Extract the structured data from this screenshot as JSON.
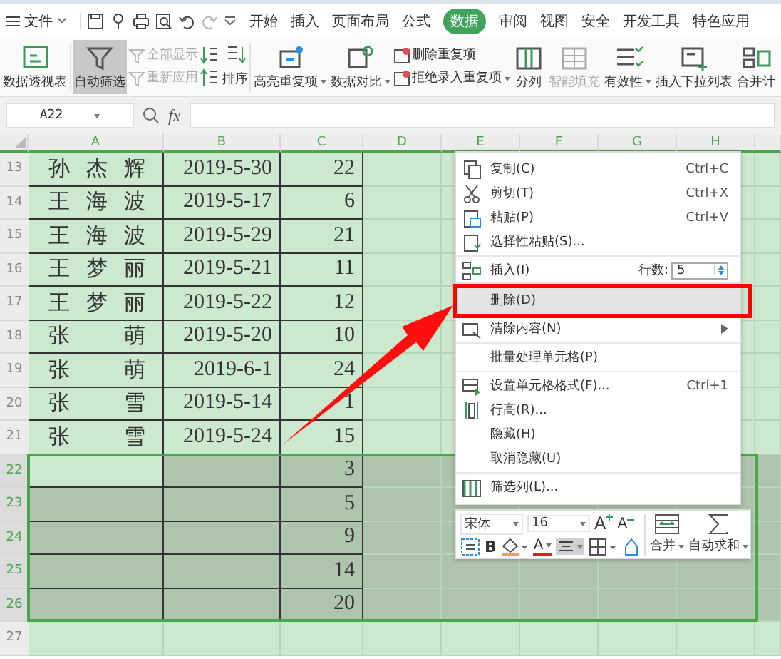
{
  "menu_bar": {
    "file": "文件",
    "tabs": [
      {
        "label": "开始",
        "selected": false
      },
      {
        "label": "插入",
        "selected": false
      },
      {
        "label": "页面布局",
        "selected": false
      },
      {
        "label": "公式",
        "selected": false
      },
      {
        "label": "数据",
        "selected": true
      },
      {
        "label": "审阅",
        "selected": false
      },
      {
        "label": "视图",
        "selected": false
      },
      {
        "label": "安全",
        "selected": false
      },
      {
        "label": "开发工具",
        "selected": false
      },
      {
        "label": "特色应用",
        "selected": false
      }
    ]
  },
  "ribbon": [
    {
      "kind": "large",
      "label": "数据透视表",
      "on": false,
      "disabled": false,
      "dropdown": false
    },
    {
      "kind": "large",
      "label": "自动筛选",
      "on": true,
      "disabled": false,
      "dropdown": false
    },
    {
      "kind": "stack",
      "items": [
        {
          "label": "全部显示",
          "disabled": true,
          "dropdown": false
        },
        {
          "label": "重新应用",
          "disabled": true,
          "dropdown": false
        }
      ]
    },
    {
      "kind": "sort",
      "label": "排序"
    },
    {
      "kind": "large",
      "label": "高亮重复项",
      "on": false,
      "disabled": false,
      "dropdown": true
    },
    {
      "kind": "large",
      "label": "数据对比",
      "on": false,
      "disabled": false,
      "dropdown": true
    },
    {
      "kind": "stack",
      "items": [
        {
          "label": "删除重复项",
          "disabled": false,
          "dropdown": false
        },
        {
          "label": "拒绝录入重复项",
          "disabled": false,
          "dropdown": true
        }
      ]
    },
    {
      "kind": "large",
      "label": "分列",
      "on": false,
      "disabled": false,
      "dropdown": false
    },
    {
      "kind": "large",
      "label": "智能填充",
      "on": false,
      "disabled": true,
      "dropdown": false
    },
    {
      "kind": "large",
      "label": "有效性",
      "on": false,
      "disabled": false,
      "dropdown": true
    },
    {
      "kind": "large",
      "label": "插入下拉列表",
      "on": false,
      "disabled": false,
      "dropdown": false
    },
    {
      "kind": "large",
      "label": "合并计",
      "on": false,
      "disabled": false,
      "dropdown": false
    }
  ],
  "formula_bar": {
    "name_box": "A22",
    "fx": "fx"
  },
  "columns": [
    "A",
    "B",
    "C",
    "D",
    "E",
    "F",
    "G",
    "H"
  ],
  "rows": [
    {
      "number": "13",
      "selected": false,
      "cells": [
        "孙杰辉",
        "2019-5-30",
        "22"
      ]
    },
    {
      "number": "14",
      "selected": false,
      "cells": [
        "王海波",
        "2019-5-17",
        "6"
      ]
    },
    {
      "number": "15",
      "selected": false,
      "cells": [
        "王海波",
        "2019-5-29",
        "21"
      ]
    },
    {
      "number": "16",
      "selected": false,
      "cells": [
        "王梦丽",
        "2019-5-21",
        "11"
      ]
    },
    {
      "number": "17",
      "selected": false,
      "cells": [
        "王梦丽",
        "2019-5-22",
        "12"
      ]
    },
    {
      "number": "18",
      "selected": false,
      "cells": [
        "张萌",
        "2019-5-20",
        "10"
      ]
    },
    {
      "number": "19",
      "selected": false,
      "cells": [
        "张萌",
        "2019-6-1",
        "24"
      ]
    },
    {
      "number": "20",
      "selected": false,
      "cells": [
        "张雪",
        "2019-5-14",
        "1"
      ]
    },
    {
      "number": "21",
      "selected": false,
      "cells": [
        "张雪",
        "2019-5-24",
        "15"
      ]
    },
    {
      "number": "22",
      "selected": true,
      "cells": [
        "",
        "",
        "3"
      ]
    },
    {
      "number": "23",
      "selected": true,
      "cells": [
        "",
        "",
        "5"
      ]
    },
    {
      "number": "24",
      "selected": true,
      "cells": [
        "",
        "",
        "9"
      ]
    },
    {
      "number": "25",
      "selected": true,
      "cells": [
        "",
        "",
        "14"
      ]
    },
    {
      "number": "26",
      "selected": true,
      "cells": [
        "",
        "",
        "20"
      ]
    },
    {
      "number": "27",
      "selected": false,
      "cells": [
        "",
        "",
        ""
      ]
    }
  ],
  "context_menu": [
    {
      "kind": "item",
      "label": "复制(C)",
      "shortcut": "Ctrl+C",
      "hovered": false,
      "submenu": false
    },
    {
      "kind": "item",
      "label": "剪切(T)",
      "shortcut": "Ctrl+X",
      "hovered": false,
      "submenu": false
    },
    {
      "kind": "item",
      "label": "粘贴(P)",
      "shortcut": "Ctrl+V",
      "hovered": false,
      "submenu": false
    },
    {
      "kind": "item",
      "label": "选择性粘贴(S)...",
      "hovered": false,
      "submenu": false
    },
    {
      "kind": "separator"
    },
    {
      "kind": "insert",
      "label": "插入(I)",
      "count_label": "行数:",
      "count": "5",
      "hovered": false
    },
    {
      "kind": "item",
      "label": "删除(D)",
      "hovered": true,
      "submenu": false
    },
    {
      "kind": "item",
      "label": "清除内容(N)",
      "hovered": false,
      "submenu": true
    },
    {
      "kind": "separator"
    },
    {
      "kind": "item",
      "label": "批量处理单元格(P)",
      "hovered": false,
      "submenu": false
    },
    {
      "kind": "separator"
    },
    {
      "kind": "item",
      "label": "设置单元格格式(F)...",
      "shortcut": "Ctrl+1",
      "hovered": false,
      "submenu": false
    },
    {
      "kind": "item",
      "label": "行高(R)...",
      "hovered": false,
      "submenu": false
    },
    {
      "kind": "item",
      "label": "隐藏(H)",
      "hovered": false,
      "submenu": false
    },
    {
      "kind": "item",
      "label": "取消隐藏(U)",
      "hovered": false,
      "submenu": false
    },
    {
      "kind": "separator"
    },
    {
      "kind": "item",
      "label": "筛选列(L)...",
      "hovered": false,
      "submenu": false
    }
  ],
  "mini_toolbar": {
    "font": "宋体",
    "size": "16",
    "grow": "A",
    "shrink": "A",
    "bold": "B",
    "font_color": "A",
    "merge": "合并",
    "autosum": "自动求和",
    "align_on": true
  }
}
